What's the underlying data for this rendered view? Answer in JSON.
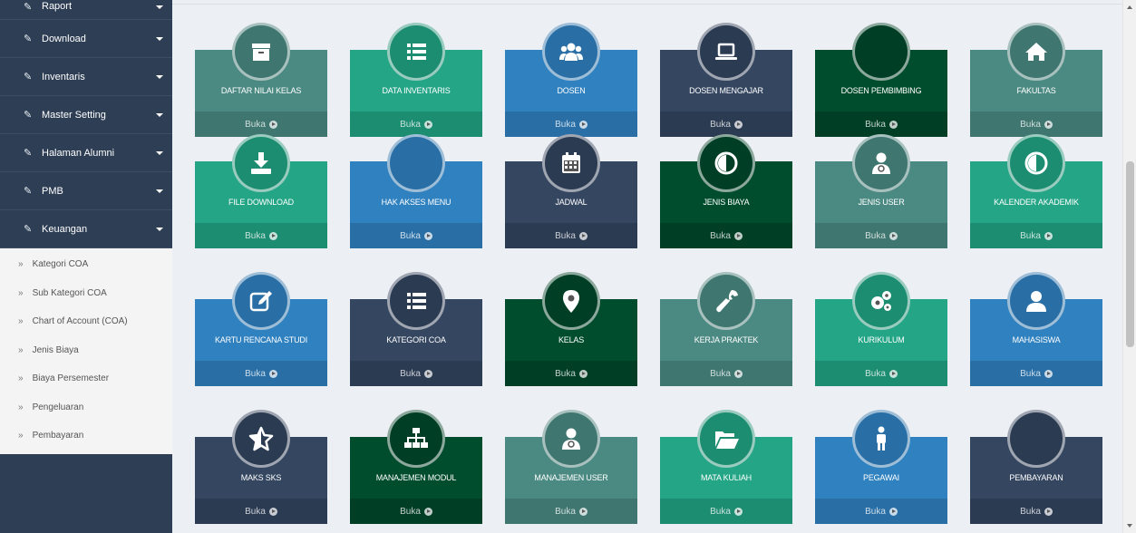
{
  "sidebar": {
    "top_item": "Raport",
    "menu": [
      {
        "label": "Download"
      },
      {
        "label": "Inventaris"
      },
      {
        "label": "Master Setting"
      },
      {
        "label": "Halaman Alumni"
      },
      {
        "label": "PMB"
      },
      {
        "label": "Keuangan"
      }
    ],
    "submenu": [
      "Kategori COA",
      "Sub Kategori COA",
      "Chart of Account (COA)",
      "Jenis Biaya",
      "Biaya Persemester",
      "Pengeluaran",
      "Pembayaran"
    ]
  },
  "tile_footer": "Buka",
  "tiles": [
    {
      "label": "DAFTAR NILAI KELAS",
      "icon": "archive-icon",
      "color": "#4b8a82",
      "foot": "#3f7670",
      "circle": "#3f7670"
    },
    {
      "label": "DATA INVENTARIS",
      "icon": "list-icon",
      "color": "#23a586",
      "foot": "#1d8d72",
      "circle": "#1d8d72"
    },
    {
      "label": "DOSEN",
      "icon": "users-icon",
      "color": "#2f81c0",
      "foot": "#296fa6",
      "circle": "#296fa6"
    },
    {
      "label": "DOSEN MENGAJAR",
      "icon": "laptop-icon",
      "color": "#344660",
      "foot": "#2b3b52",
      "circle": "#2b3b52"
    },
    {
      "label": "DOSEN PEMBIMBING",
      "icon": "",
      "color": "#004d2d",
      "foot": "#003f25",
      "circle": "#003f25"
    },
    {
      "label": "FAKULTAS",
      "icon": "home-icon",
      "color": "#4b8a82",
      "foot": "#3f7670",
      "circle": "#3f7670"
    },
    {
      "label": "FILE DOWNLOAD",
      "icon": "download-icon",
      "color": "#23a586",
      "foot": "#1d8d72",
      "circle": "#1d8d72"
    },
    {
      "label": "HAK AKSES MENU",
      "icon": "",
      "color": "#2f81c0",
      "foot": "#296fa6",
      "circle": "#296fa6"
    },
    {
      "label": "JADWAL",
      "icon": "calendar-icon",
      "color": "#344660",
      "foot": "#2b3b52",
      "circle": "#2b3b52"
    },
    {
      "label": "JENIS BIAYA",
      "icon": "contrast-icon",
      "color": "#004d2d",
      "foot": "#003f25",
      "circle": "#003f25"
    },
    {
      "label": "JENIS USER",
      "icon": "user-md-icon",
      "color": "#4b8a82",
      "foot": "#3f7670",
      "circle": "#3f7670"
    },
    {
      "label": "KALENDER AKADEMIK",
      "icon": "contrast-icon",
      "color": "#23a586",
      "foot": "#1d8d72",
      "circle": "#1d8d72"
    },
    {
      "label": "KARTU RENCANA STUDI",
      "icon": "edit-icon",
      "color": "#2f81c0",
      "foot": "#296fa6",
      "circle": "#296fa6"
    },
    {
      "label": "KATEGORI COA",
      "icon": "list-icon",
      "color": "#344660",
      "foot": "#2b3b52",
      "circle": "#2b3b52"
    },
    {
      "label": "KELAS",
      "icon": "map-marker-icon",
      "color": "#004d2d",
      "foot": "#003f25",
      "circle": "#003f25"
    },
    {
      "label": "KERJA PRAKTEK",
      "icon": "wrench-icon",
      "color": "#4b8a82",
      "foot": "#3f7670",
      "circle": "#3f7670"
    },
    {
      "label": "KURIKULUM",
      "icon": "cogs-icon",
      "color": "#23a586",
      "foot": "#1d8d72",
      "circle": "#1d8d72"
    },
    {
      "label": "MAHASISWA",
      "icon": "user-icon",
      "color": "#2f81c0",
      "foot": "#296fa6",
      "circle": "#296fa6"
    },
    {
      "label": "MAKS SKS",
      "icon": "star-half-icon",
      "color": "#344660",
      "foot": "#2b3b52",
      "circle": "#2b3b52"
    },
    {
      "label": "MANAJEMEN MODUL",
      "icon": "sitemap-icon",
      "color": "#004d2d",
      "foot": "#003f25",
      "circle": "#003f25"
    },
    {
      "label": "MANAJEMEN USER",
      "icon": "user-md-icon",
      "color": "#4b8a82",
      "foot": "#3f7670",
      "circle": "#3f7670"
    },
    {
      "label": "MATA KULIAH",
      "icon": "folder-open-icon",
      "color": "#23a586",
      "foot": "#1d8d72",
      "circle": "#1d8d72"
    },
    {
      "label": "PEGAWAI",
      "icon": "male-icon",
      "color": "#2f81c0",
      "foot": "#296fa6",
      "circle": "#296fa6"
    },
    {
      "label": "PEMBAYARAN",
      "icon": "",
      "color": "#344660",
      "foot": "#2b3b52",
      "circle": "#2b3b52"
    }
  ]
}
